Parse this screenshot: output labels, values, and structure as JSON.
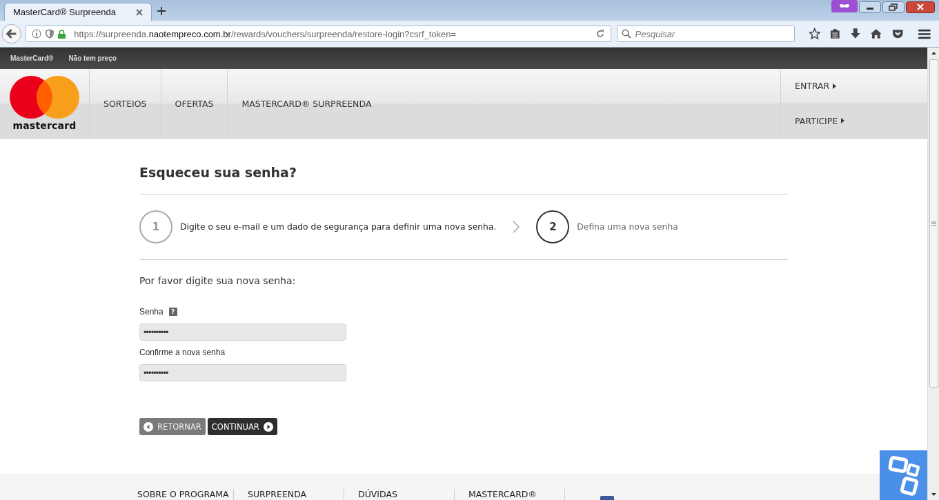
{
  "browser": {
    "tab_title": "MasterCard® Surpreenda",
    "url": {
      "prefix": "https://surpreenda.",
      "domain": "naotempreco.com.br",
      "path": "/rewards/vouchers/surpreenda/restore-login?csrf_token="
    },
    "search": {
      "placeholder": "Pesquisar"
    }
  },
  "topbar": {
    "links": [
      "MasterCard®",
      "Não tem preço"
    ]
  },
  "header": {
    "logo_text": "mastercard",
    "nav": [
      "SORTEIOS",
      "OFERTAS",
      "MASTERCARD® SURPREENDA"
    ],
    "actions": [
      "ENTRAR",
      "PARTICIPE"
    ]
  },
  "page": {
    "title": "Esqueceu sua senha?",
    "steps": [
      {
        "number": "1",
        "text": "Digite o seu e-mail e um dado de segurança para definir uma nova senha.",
        "selected": false
      },
      {
        "number": "2",
        "text": "Defina uma nova senha",
        "selected": true
      }
    ],
    "prompt": "Por favor digite sua nova senha:",
    "fields": [
      {
        "label": "Senha",
        "help": "?",
        "value": "••••••••••"
      },
      {
        "label": "Confirme a nova senha",
        "value": "••••••••••"
      }
    ],
    "buttons": [
      {
        "label": "RETORNAR",
        "kind": "back"
      },
      {
        "label": "CONTINUAR",
        "kind": "next"
      }
    ]
  },
  "footer": {
    "columns": [
      "SOBRE O PROGRAMA",
      "SURPREENDA",
      "DÚVIDAS",
      "MASTERCARD®"
    ]
  }
}
